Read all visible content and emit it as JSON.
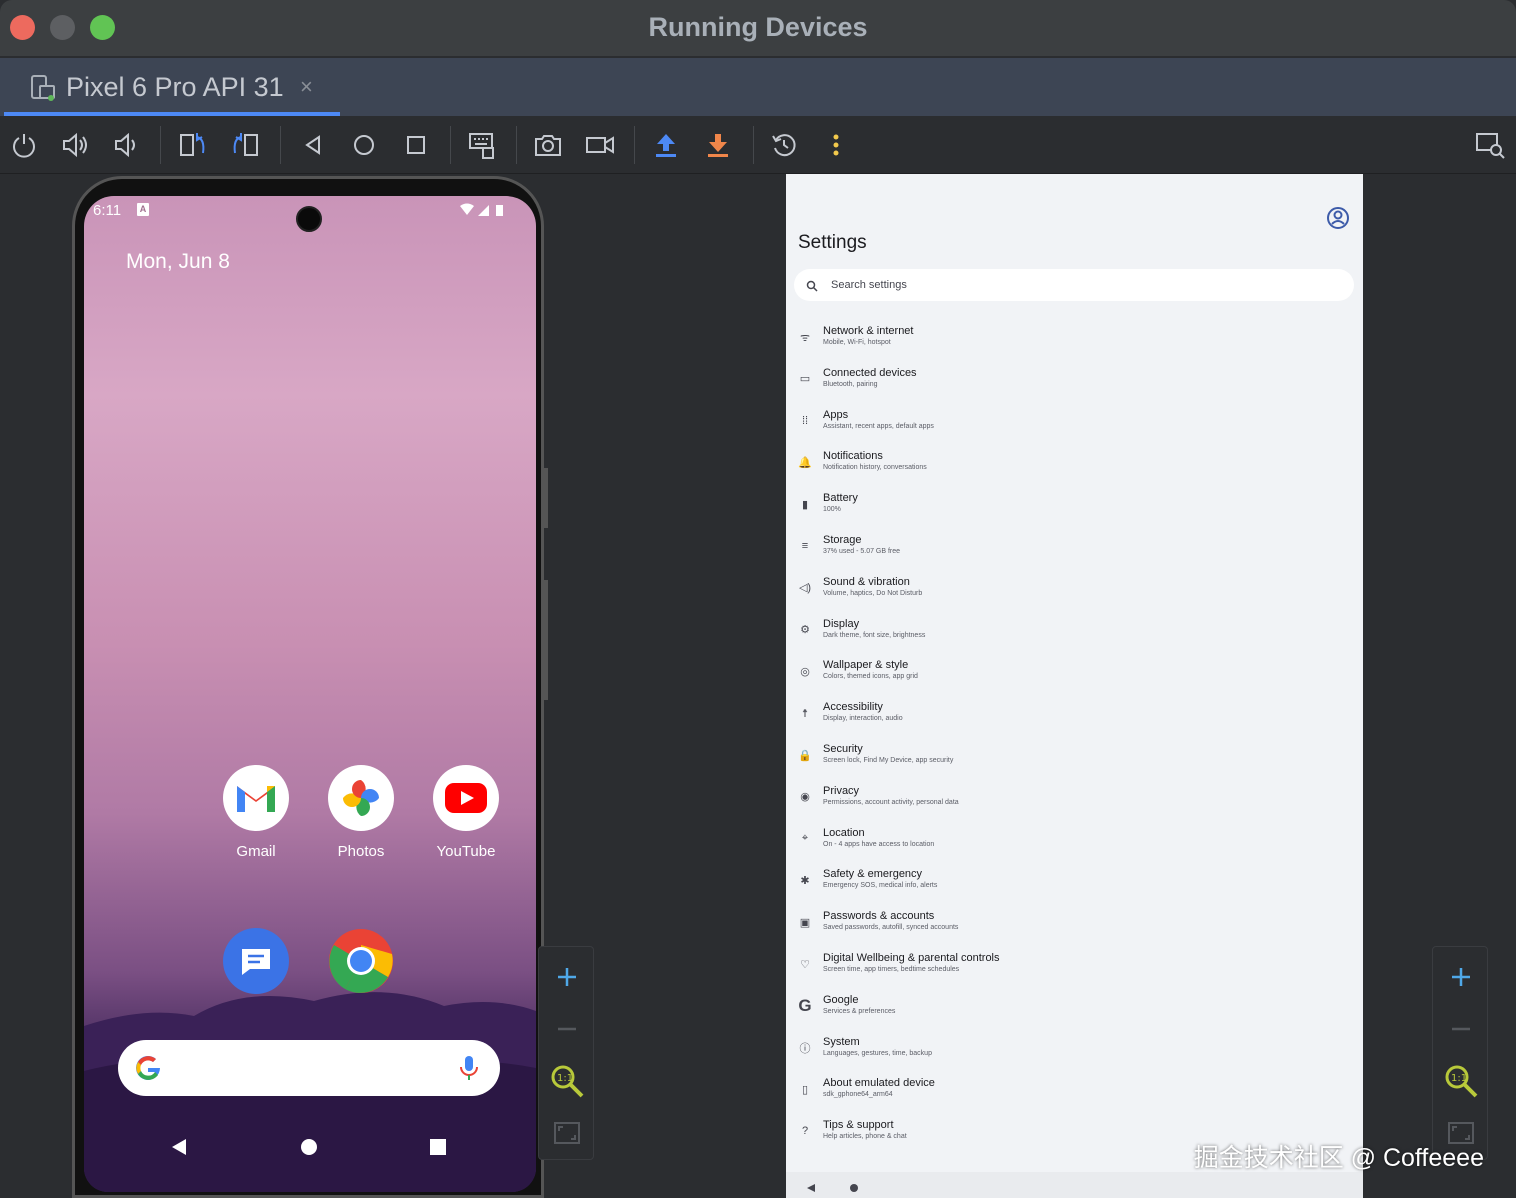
{
  "window": {
    "title": "Running Devices"
  },
  "tab": {
    "label": "Pixel 6 Pro API 31",
    "close": "×"
  },
  "toolbar": {
    "buttons": [
      "power-icon",
      "volume-up-icon",
      "volume-down-icon",
      "rotate-left-icon",
      "rotate-right-icon",
      "back-icon",
      "home-icon",
      "overview-icon",
      "keyboard-icon",
      "screenshot-icon",
      "screen-record-icon",
      "push-icon",
      "pull-icon",
      "snapshot-icon",
      "more-icon",
      "device-explorer-icon"
    ],
    "accent": "#4d89f5",
    "download_color": "#f0864a",
    "more_color": "#f2c94c"
  },
  "phone": {
    "status_time": "6:11",
    "status_badge": "A",
    "date": "Mon, Jun 8",
    "apps": [
      {
        "label": "Gmail"
      },
      {
        "label": "Photos"
      },
      {
        "label": "YouTube"
      },
      {
        "label": ""
      },
      {
        "label": ""
      }
    ]
  },
  "settings": {
    "title": "Settings",
    "search_placeholder": "Search settings",
    "items": [
      {
        "title": "Network & internet",
        "subtitle": "Mobile, Wi-Fi, hotspot",
        "icon": "wifi-icon"
      },
      {
        "title": "Connected devices",
        "subtitle": "Bluetooth, pairing",
        "icon": "devices-icon"
      },
      {
        "title": "Apps",
        "subtitle": "Assistant, recent apps, default apps",
        "icon": "apps-icon"
      },
      {
        "title": "Notifications",
        "subtitle": "Notification history, conversations",
        "icon": "bell-icon"
      },
      {
        "title": "Battery",
        "subtitle": "100%",
        "icon": "battery-icon"
      },
      {
        "title": "Storage",
        "subtitle": "37% used - 5.07 GB free",
        "icon": "storage-icon"
      },
      {
        "title": "Sound & vibration",
        "subtitle": "Volume, haptics, Do Not Disturb",
        "icon": "sound-icon"
      },
      {
        "title": "Display",
        "subtitle": "Dark theme, font size, brightness",
        "icon": "display-icon"
      },
      {
        "title": "Wallpaper & style",
        "subtitle": "Colors, themed icons, app grid",
        "icon": "palette-icon"
      },
      {
        "title": "Accessibility",
        "subtitle": "Display, interaction, audio",
        "icon": "accessibility-icon"
      },
      {
        "title": "Security",
        "subtitle": "Screen lock, Find My Device, app security",
        "icon": "lock-icon"
      },
      {
        "title": "Privacy",
        "subtitle": "Permissions, account activity, personal data",
        "icon": "privacy-icon"
      },
      {
        "title": "Location",
        "subtitle": "On - 4 apps have access to location",
        "icon": "location-icon"
      },
      {
        "title": "Safety & emergency",
        "subtitle": "Emergency SOS, medical info, alerts",
        "icon": "emergency-icon"
      },
      {
        "title": "Passwords & accounts",
        "subtitle": "Saved passwords, autofill, synced accounts",
        "icon": "accounts-icon"
      },
      {
        "title": "Digital Wellbeing & parental controls",
        "subtitle": "Screen time, app timers, bedtime schedules",
        "icon": "wellbeing-icon"
      },
      {
        "title": "Google",
        "subtitle": "Services & preferences",
        "icon": "google-icon"
      },
      {
        "title": "System",
        "subtitle": "Languages, gestures, time, backup",
        "icon": "info-icon"
      },
      {
        "title": "About emulated device",
        "subtitle": "sdk_gphone64_arm64",
        "icon": "phone-icon"
      },
      {
        "title": "Tips & support",
        "subtitle": "Help articles, phone & chat",
        "icon": "help-icon"
      }
    ]
  },
  "zoom": {
    "zoom_in": "+",
    "zoom_out": "—",
    "actual_size": "1:1"
  },
  "watermark": "掘金技术社区 @ Coffeeee"
}
